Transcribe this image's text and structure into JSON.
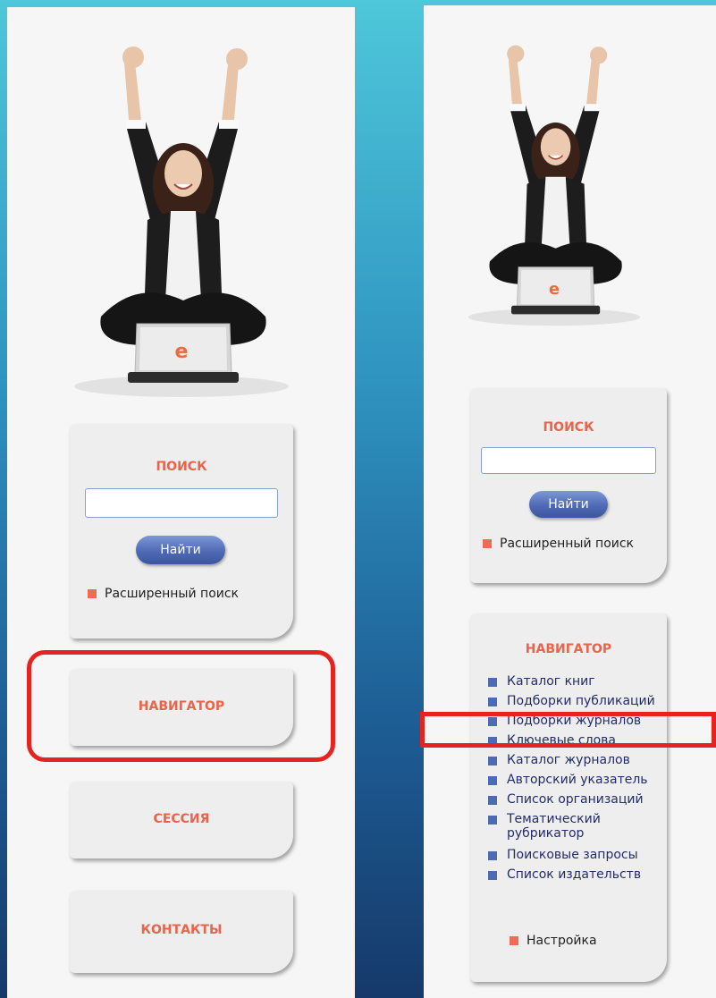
{
  "search": {
    "title": "ПОИСК",
    "input_value": "",
    "button_label": "Найти",
    "advanced_label": "Расширенный поиск"
  },
  "left_menu": {
    "navigator": "НАВИГАТОР",
    "session": "СЕССИЯ",
    "contacts": "КОНТАКТЫ"
  },
  "navigator": {
    "title": "НАВИГАТОР",
    "items": [
      {
        "label": "Каталог книг"
      },
      {
        "label": "Подборки публикаций"
      },
      {
        "label": "Подборки журналов"
      },
      {
        "label": "Ключевые слова"
      },
      {
        "label": "Каталог журналов"
      },
      {
        "label": "Авторский указатель"
      },
      {
        "label": "Список организаций"
      },
      {
        "label": "Тематический рубрикатор"
      },
      {
        "label": "Поисковые запросы"
      },
      {
        "label": "Список издательств"
      }
    ],
    "settings_label": "Настройка"
  },
  "colors": {
    "accent": "#e8644b",
    "highlight": "#e52421",
    "button": "#4f6ab5",
    "nav_bullet": "#4d6bb3"
  },
  "icons": {
    "hero": "woman-with-laptop-illustration",
    "laptop_logo": "e-logo"
  }
}
